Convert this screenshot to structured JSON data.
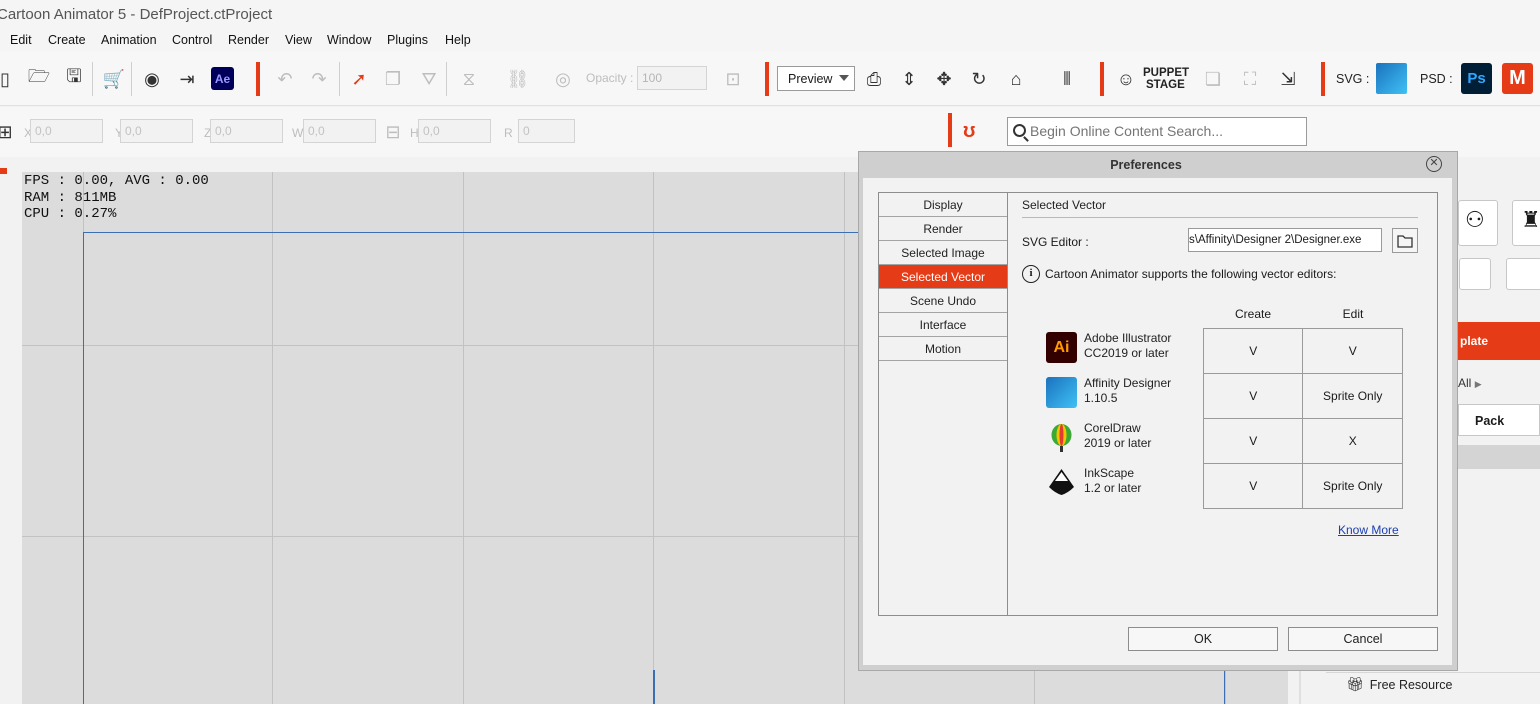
{
  "window": {
    "title": "Cartoon Animator 5 - DefProject.ctProject"
  },
  "menu": [
    "Edit",
    "Create",
    "Animation",
    "Control",
    "Render",
    "View",
    "Window",
    "Plugins",
    "Help"
  ],
  "toolbar": {
    "ae_label": "Ae",
    "opacity_label": "Opacity :",
    "opacity_value": "100",
    "preview_label": "Preview",
    "puppet_line1": "PUPPET",
    "puppet_line2": "STAGE",
    "svg_label": "SVG :",
    "psd_label": "PSD :",
    "ps_label": "Ps",
    "m_label": "M"
  },
  "transform": {
    "x_label": "X",
    "x_value": "0,0",
    "y_label": "Y",
    "y_value": "0,0",
    "z_label": "Z",
    "z_value": "0,0",
    "w_label": "W",
    "w_value": "0,0",
    "h_label": "H",
    "h_value": "0,0",
    "r_label": "R",
    "r_value": "0"
  },
  "search": {
    "placeholder": "Begin Online Content Search..."
  },
  "stats": {
    "fps": "FPS : 0.00, AVG : 0.00",
    "ram": "RAM : 811MB",
    "cpu": "CPU : 0.27%"
  },
  "preferences": {
    "title": "Preferences",
    "categories": [
      "Display",
      "Render",
      "Selected Image",
      "Selected Vector",
      "Scene Undo",
      "Interface",
      "Motion"
    ],
    "active_category": "Selected Vector",
    "section_title": "Selected Vector",
    "svg_editor_label": "SVG Editor :",
    "svg_editor_path": "s\\Affinity\\Designer 2\\Designer.exe",
    "info_text": "Cartoon Animator supports the following vector editors:",
    "columns": [
      "Create",
      "Edit"
    ],
    "editors": [
      {
        "name": "Adobe Illustrator",
        "version": "CC2019 or later",
        "create": "V",
        "edit": "V"
      },
      {
        "name": "Affinity Designer",
        "version": "1.10.5",
        "create": "V",
        "edit": "Sprite Only"
      },
      {
        "name": "CorelDraw",
        "version": "2019 or later",
        "create": "V",
        "edit": "X"
      },
      {
        "name": "InkScape",
        "version": "1.2 or later",
        "create": "V",
        "edit": "Sprite Only"
      }
    ],
    "ai_logo_text": "Ai",
    "know_more": "Know More",
    "ok": "OK",
    "cancel": "Cancel"
  },
  "right_panel": {
    "red_button": "plate",
    "all_label": "All",
    "pack_label": "Pack",
    "free_resource": "Free Resource"
  },
  "colors": {
    "accent": "#e63b17",
    "stage_border": "#3b6fb5"
  }
}
